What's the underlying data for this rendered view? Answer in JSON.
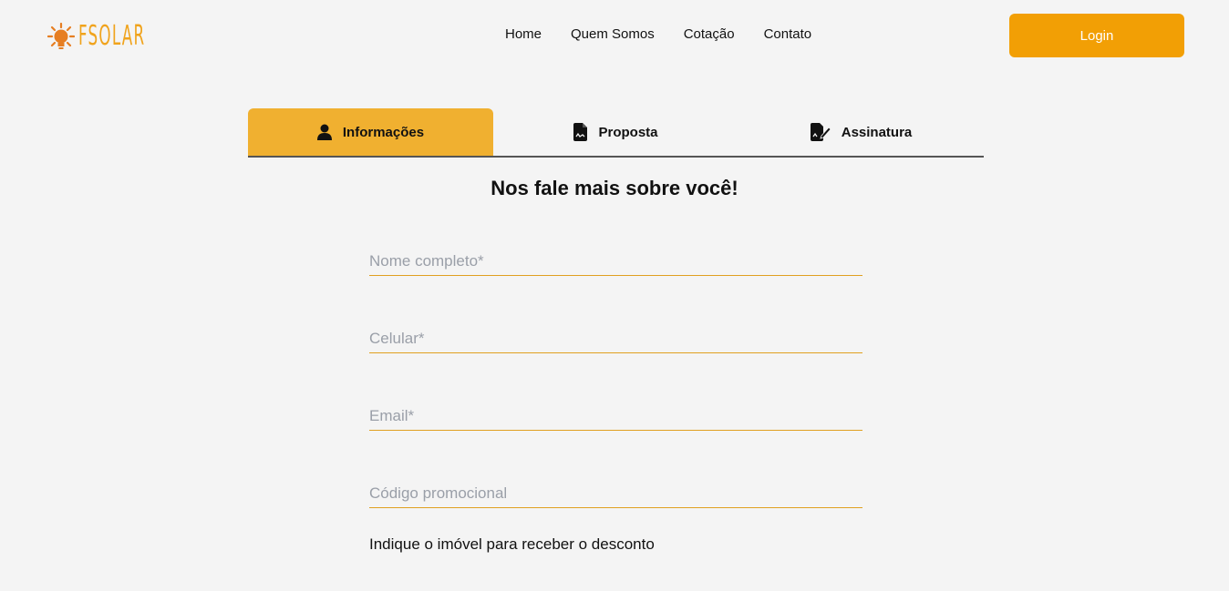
{
  "brand": {
    "name": "FSOLAR",
    "accent": "#f29f05"
  },
  "nav": {
    "items": [
      {
        "label": "Home"
      },
      {
        "label": "Quem Somos"
      },
      {
        "label": "Cotação"
      },
      {
        "label": "Contato"
      }
    ],
    "login_label": "Login"
  },
  "tabs": [
    {
      "label": "Informações",
      "icon": "user-icon",
      "active": true
    },
    {
      "label": "Proposta",
      "icon": "document-icon",
      "active": false
    },
    {
      "label": "Assinatura",
      "icon": "signature-icon",
      "active": false
    }
  ],
  "form": {
    "title": "Nos fale mais sobre você!",
    "fields": {
      "name": {
        "placeholder": "Nome completo*",
        "value": ""
      },
      "phone": {
        "placeholder": "Celular*",
        "value": ""
      },
      "email": {
        "placeholder": "Email*",
        "value": ""
      },
      "promo": {
        "placeholder": "Código promocional",
        "value": ""
      }
    },
    "hint": "Indique o imóvel para receber o desconto"
  }
}
